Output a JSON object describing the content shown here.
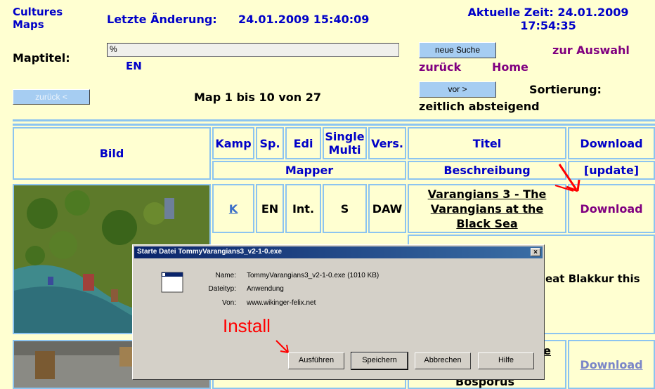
{
  "header": {
    "site_line1": "Cultures",
    "site_line2": "Maps",
    "last_change_label": "Letzte Änderung:",
    "last_change_value": "24.01.2009 15:40:09",
    "current_time_line1": "Aktuelle Zeit: 24.01.2009",
    "current_time_line2": "17:54:35"
  },
  "search": {
    "label": "Maptitel:",
    "value": "%",
    "lang": "EN",
    "new_search_button": "neue Suche",
    "back_link": "zurück",
    "home_link": "Home",
    "selection_link": "zur Auswahl"
  },
  "pagination": {
    "prev_button": "zurück <",
    "info": "Map 1 bis 10 von 27",
    "next_button": "vor >",
    "sort_label": "Sortierung:",
    "sort_value": "zeitlich absteigend"
  },
  "table": {
    "headers": {
      "image": "Bild",
      "campaign": "Kamp",
      "language": "Sp.",
      "editor": "Edi",
      "single": "Single",
      "multi": "Multi",
      "version": "Vers.",
      "title": "Titel",
      "download": "Download",
      "mapper": "Mapper",
      "description": "Beschreibung",
      "update": "[update]"
    },
    "rows": [
      {
        "campaign": "K",
        "language": "EN",
        "editor": "Int.",
        "mode": "S",
        "version": "DAW",
        "title": "Varangians 3 - The Varangians at the Black Sea",
        "download": "Download",
        "description_fragment": "eat Blakkur this"
      },
      {
        "title_fragment": "e",
        "title_fragment_bottom": "Bosporus",
        "download": "Download"
      }
    ]
  },
  "dialog": {
    "title": "Starte Datei TommyVarangians3_v2-1-0.exe",
    "close": "×",
    "name_label": "Name:",
    "name_value": "TommyVarangians3_v2-1-0.exe (1010 KB)",
    "type_label": "Dateityp:",
    "type_value": "Anwendung",
    "from_label": "Von:",
    "from_value": "www.wikinger-felix.net",
    "buttons": {
      "run": "Ausführen",
      "save": "Speichern",
      "cancel": "Abbrechen",
      "help": "Hilfe"
    }
  },
  "annotation": {
    "text": "Install",
    "color": "#ff0000"
  },
  "colors": {
    "page_bg": "#ffffd1",
    "header_blue": "#0000c8",
    "link_purple": "#800080",
    "border_blue": "#8cc4f0",
    "button_blue": "#a6cdf2",
    "dialog_gray": "#d4d0c8"
  }
}
